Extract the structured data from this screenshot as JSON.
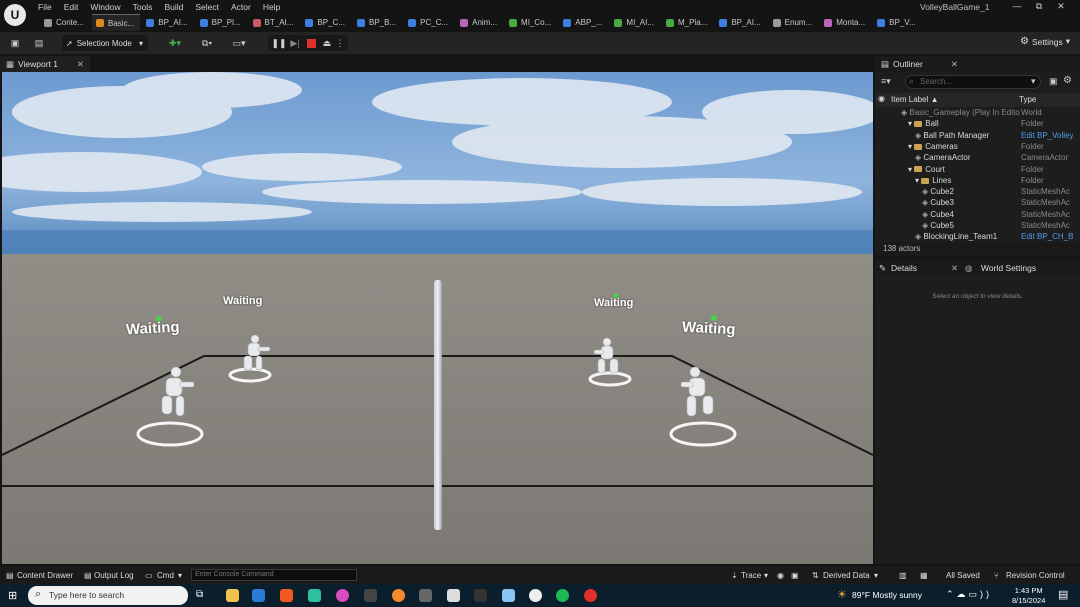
{
  "window": {
    "menu": [
      "File",
      "Edit",
      "Window",
      "Tools",
      "Build",
      "Select",
      "Actor",
      "Help"
    ],
    "app_title": "VolleyBallGame_1",
    "controls": [
      "—",
      "⧉",
      "✕"
    ],
    "tabs": [
      {
        "label": "Conte...",
        "color": "#9a9a9a"
      },
      {
        "label": "Basic...",
        "color": "#e08a1c",
        "active": true
      },
      {
        "label": "BP_AI...",
        "color": "#3b7fe0"
      },
      {
        "label": "BP_Pl...",
        "color": "#3b7fe0"
      },
      {
        "label": "BT_AI...",
        "color": "#c95c6a"
      },
      {
        "label": "BP_C...",
        "color": "#3b7fe0"
      },
      {
        "label": "BP_B...",
        "color": "#3b7fe0"
      },
      {
        "label": "PC_C...",
        "color": "#3b7fe0"
      },
      {
        "label": "Anim...",
        "color": "#bb66bb"
      },
      {
        "label": "MI_Co...",
        "color": "#44aa44"
      },
      {
        "label": "ABP_...",
        "color": "#3b7fe0"
      },
      {
        "label": "MI_AI...",
        "color": "#44aa44"
      },
      {
        "label": "M_Pla...",
        "color": "#44aa44"
      },
      {
        "label": "BP_AI...",
        "color": "#3b7fe0"
      },
      {
        "label": "Enum...",
        "color": "#9a9a9a"
      },
      {
        "label": "Monta...",
        "color": "#bb66bb"
      },
      {
        "label": "BP_V...",
        "color": "#3b7fe0"
      }
    ]
  },
  "toolbar": {
    "selection_mode": "Selection Mode",
    "settings": "Settings"
  },
  "viewport": {
    "tab_label": "Viewport 1",
    "labels": [
      "Waiting",
      "Waiting",
      "Waiting",
      "Waiting"
    ]
  },
  "outliner": {
    "title": "Outliner",
    "search_placeholder": "Search...",
    "col_label": "Item Label ▲",
    "col_type": "Type",
    "rows": [
      {
        "label": "Basic_Gameplay (Play In Edito",
        "type": "World",
        "indent": 0,
        "folder": false,
        "dim": true
      },
      {
        "label": "Ball",
        "type": "Folder",
        "indent": 1,
        "folder": true
      },
      {
        "label": "Ball Path Manager",
        "type": "Edit BP_Volley",
        "indent": 2,
        "folder": false,
        "link": true
      },
      {
        "label": "Cameras",
        "type": "Folder",
        "indent": 1,
        "folder": true
      },
      {
        "label": "CameraActor",
        "type": "CameraActor",
        "indent": 2,
        "folder": false
      },
      {
        "label": "Court",
        "type": "Folder",
        "indent": 1,
        "folder": true
      },
      {
        "label": "Lines",
        "type": "Folder",
        "indent": 2,
        "folder": true
      },
      {
        "label": "Cube2",
        "type": "StaticMeshAc",
        "indent": 3,
        "folder": false
      },
      {
        "label": "Cube3",
        "type": "StaticMeshAc",
        "indent": 3,
        "folder": false
      },
      {
        "label": "Cube4",
        "type": "StaticMeshAc",
        "indent": 3,
        "folder": false
      },
      {
        "label": "Cube5",
        "type": "StaticMeshAc",
        "indent": 3,
        "folder": false
      },
      {
        "label": "BlockingLine_Team1",
        "type": "Edit BP_CH_B",
        "indent": 2,
        "folder": false,
        "link": true
      }
    ],
    "actor_count": "138 actors"
  },
  "details": {
    "tab1": "Details",
    "tab2": "World Settings",
    "empty_message": "Select an object to view details."
  },
  "bottombar": {
    "content_drawer": "Content Drawer",
    "output_log": "Output Log",
    "cmd": "Cmd",
    "console_placeholder": "Enter Console Command",
    "trace": "Trace",
    "derived_data": "Derived Data",
    "all_saved": "All Saved",
    "revision_control": "Revision Control"
  },
  "taskbar": {
    "search_placeholder": "Type here to search",
    "weather": "89°F  Mostly sunny",
    "time": "1:43 PM",
    "date": "8/15/2024"
  }
}
